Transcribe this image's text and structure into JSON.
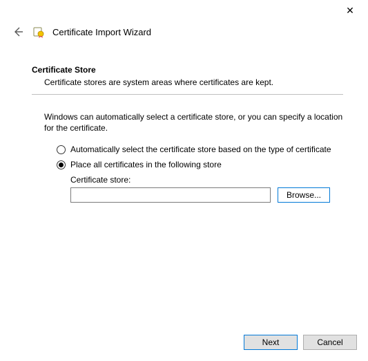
{
  "window": {
    "title": "Certificate Import Wizard"
  },
  "close_icon": "✕",
  "section": {
    "title": "Certificate Store",
    "subtitle": "Certificate stores are system areas where certificates are kept."
  },
  "description": "Windows can automatically select a certificate store, or you can specify a location for the certificate.",
  "radios": {
    "auto": "Automatically select the certificate store based on the type of certificate",
    "place": "Place all certificates in the following store",
    "selected": "place"
  },
  "store": {
    "label": "Certificate store:",
    "value": "",
    "browse_label": "Browse..."
  },
  "footer": {
    "next": "Next",
    "cancel": "Cancel"
  }
}
